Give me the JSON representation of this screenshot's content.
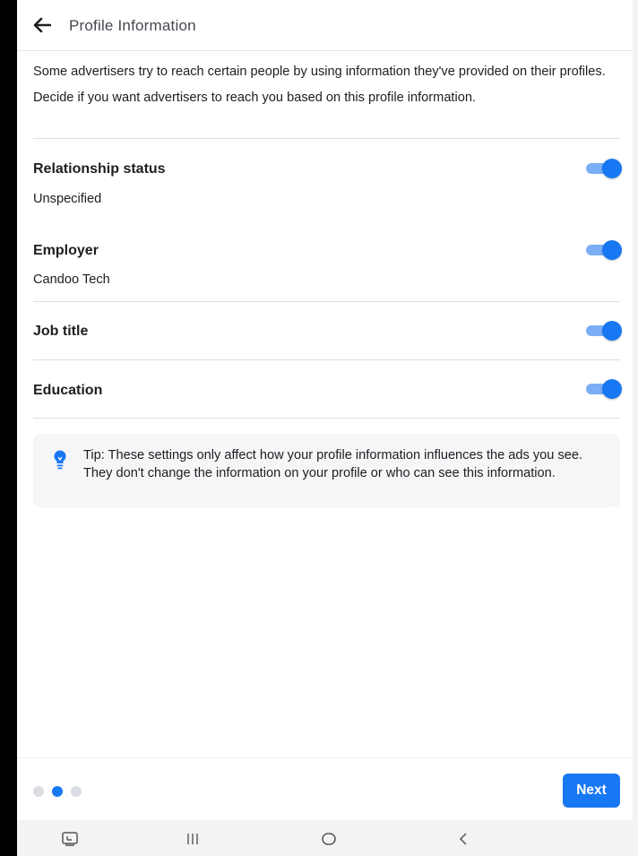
{
  "header": {
    "title": "Profile Information",
    "back_icon": "arrow-left-icon"
  },
  "intro": {
    "line1": "Some advertisers try to reach certain people by using information they've provided on their profiles.",
    "line2": "Decide if you want advertisers to reach you based on this profile information."
  },
  "settings": [
    {
      "title": "Relationship status",
      "value": "Unspecified",
      "enabled": true
    },
    {
      "title": "Employer",
      "value": "Candoo Tech",
      "enabled": true
    },
    {
      "title": "Job title",
      "value": "",
      "enabled": true
    },
    {
      "title": "Education",
      "value": "",
      "enabled": true
    }
  ],
  "tip": {
    "icon": "lightbulb-icon",
    "text": "Tip: These settings only affect how your profile information influences the ads you see. They don't change the information on your profile or who can see this information."
  },
  "footer": {
    "step_current": 2,
    "step_total": 3,
    "next_label": "Next"
  },
  "colors": {
    "accent": "#1877f2",
    "toggle_track": "#7aaef5",
    "tip_background": "#f5f6f7"
  },
  "system_nav": {
    "recents_icon": "recent-apps-icon",
    "menu_icon": "three-bars-icon",
    "home_icon": "home-circle-icon",
    "back_icon": "chevron-left-icon"
  }
}
